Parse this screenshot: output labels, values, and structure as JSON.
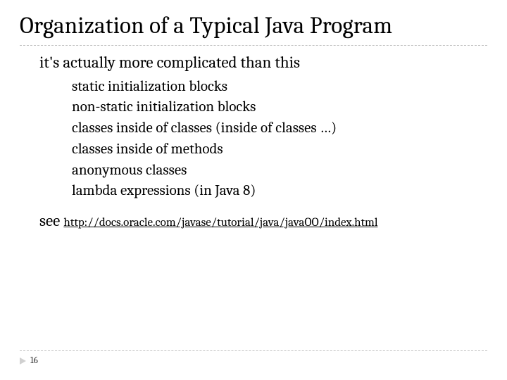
{
  "title": "Organization of a Typical Java Program",
  "bullets": {
    "main1": "it's actually more complicated than this",
    "sub": [
      "static initialization blocks",
      "non-static initialization blocks",
      "classes inside of classes (inside of classes …)",
      "classes inside of methods",
      "anonymous classes",
      "lambda expressions (in Java 8)"
    ],
    "see_label": "see",
    "see_url": "http://docs.oracle.com/javase/tutorial/java/javaOO/index.html"
  },
  "glyph": {
    "bullet": ""
  },
  "page_number": "16"
}
